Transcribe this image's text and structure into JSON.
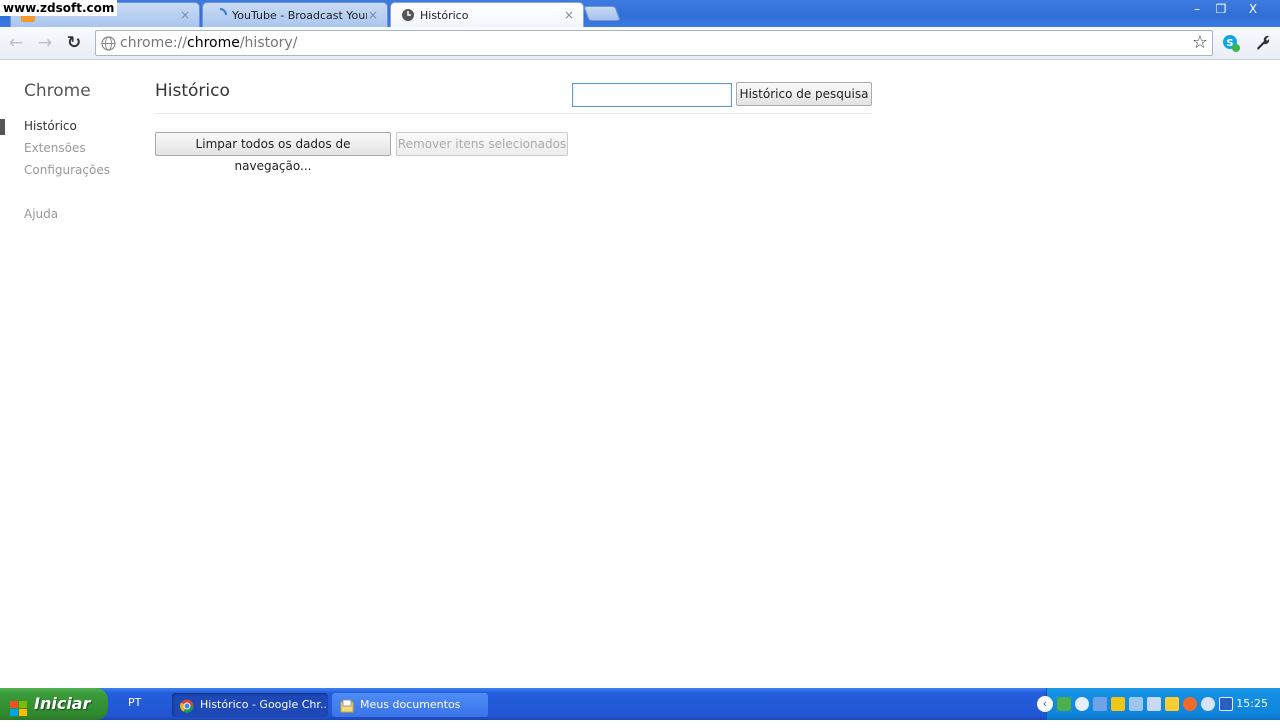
{
  "watermark": "www.zdsoft.com",
  "tabs": [
    {
      "title": "",
      "state": "inactive"
    },
    {
      "title": "YouTube - Broadcast Yourself",
      "state": "inactive"
    },
    {
      "title": "Histórico",
      "state": "active"
    }
  ],
  "window_buttons": {
    "minimize": "–",
    "restore": "❐",
    "close": "X"
  },
  "toolbar": {
    "back": "←",
    "forward": "→",
    "reload": "↻",
    "url_prefix": "chrome://",
    "url_host": "chrome",
    "url_path": "/history/",
    "star": "☆",
    "wrench": "🔧"
  },
  "sidebar": {
    "title": "Chrome",
    "items": [
      {
        "label": "Histórico",
        "selected": true
      },
      {
        "label": "Extensões",
        "selected": false
      },
      {
        "label": "Configurações",
        "selected": false
      },
      {
        "label": "Ajuda",
        "selected": false
      }
    ]
  },
  "main": {
    "title": "Histórico",
    "search_value": "",
    "search_button": "Histórico de pesquisa",
    "clear_button": "Limpar todos os dados de navegação...",
    "remove_button": "Remover itens selecionados"
  },
  "taskbar": {
    "start_label": "Iniciar",
    "language": "PT",
    "tasks": [
      {
        "label": "Histórico - Google Chr...",
        "active": true,
        "icon": "chrome-icon"
      },
      {
        "label": "Meus documentos",
        "active": false,
        "icon": "folder-icon"
      }
    ],
    "clock": "15:25"
  },
  "colors": {
    "titlebar": "#2f6fd6",
    "taskbar": "#2156d4",
    "start": "#3a9a3a",
    "tray": "#0f85db"
  }
}
